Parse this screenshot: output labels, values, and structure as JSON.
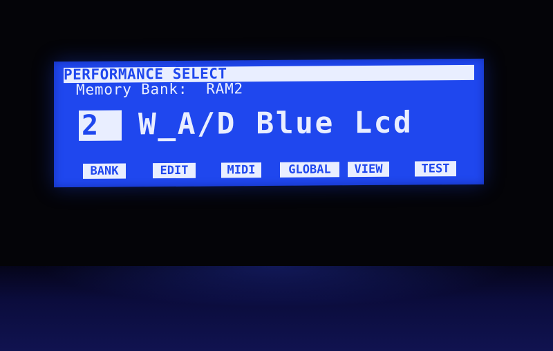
{
  "screen": {
    "title": "PERFORMANCE SELECT",
    "memory_bank_label": "Memory Bank:",
    "memory_bank_value": "RAM2",
    "performance_number": "2",
    "performance_name": "W_A/D Blue Lcd"
  },
  "softkeys": [
    {
      "label": "BANK"
    },
    {
      "label": "EDIT"
    },
    {
      "label": "MIDI"
    },
    {
      "label": "GLOBAL"
    },
    {
      "label": "VIEW"
    },
    {
      "label": "TEST"
    }
  ],
  "colors": {
    "lcd_background": "#1f47ee",
    "lcd_foreground": "#e9eeff",
    "bezel": "#040408"
  }
}
